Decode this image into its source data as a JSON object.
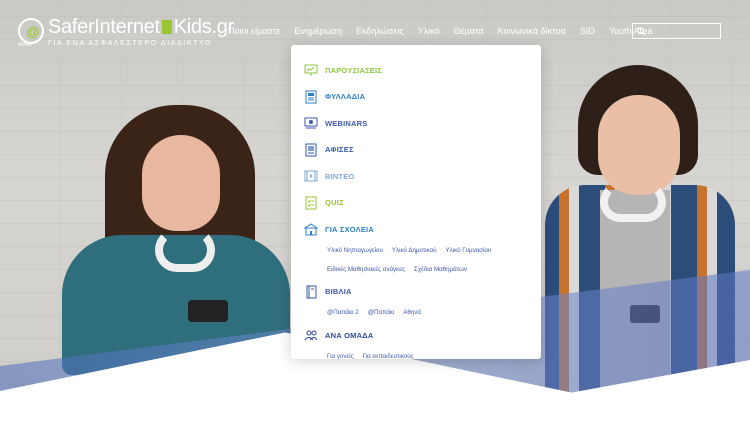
{
  "logo": {
    "part1": "SaferInternet",
    "part2": "Kids.gr",
    "tagline": "ΓΙΑ ΕΝΑ ΑΣΦΑΛΕΣΤΕΡΟ ΔΙΑΔΙΚΤΥΟ",
    "small": "www."
  },
  "nav": {
    "items": [
      {
        "label": "Ποιοι είμαστε"
      },
      {
        "label": "Ενημέρωση"
      },
      {
        "label": "Εκδηλώσεις"
      },
      {
        "label": "Υλικό"
      },
      {
        "label": "Θέματα"
      },
      {
        "label": "Κοινωνικά δίκτυα"
      },
      {
        "label": "SID"
      },
      {
        "label": "Youth Area"
      }
    ],
    "search_placeholder": ""
  },
  "menu": {
    "items": [
      {
        "label": "ΠΑΡΟΥΣΙΑΣΕΙΣ",
        "color": "#8dc63f",
        "icon": "presentation-icon"
      },
      {
        "label": "ΦΥΛΛΑΔΙΑ",
        "color": "#2f7fc8",
        "icon": "leaflet-icon"
      },
      {
        "label": "WEBINARS",
        "color": "#3d5aa8",
        "icon": "webinar-icon"
      },
      {
        "label": "ΑΦΙΣΕΣ",
        "color": "#2f5aa8",
        "icon": "poster-icon"
      },
      {
        "label": "ΒΙΝΤΕΟ",
        "color": "#7fa9d8",
        "icon": "video-icon"
      },
      {
        "label": "QUIZ",
        "color": "#9ac431",
        "icon": "quiz-icon"
      },
      {
        "label": "ΓΙΑ ΣΧΟΛΕΙΑ",
        "color": "#2f7fc8",
        "icon": "school-icon"
      },
      {
        "label": "ΒΙΒΛΙΑ",
        "color": "#3d5aa8",
        "icon": "book-icon"
      },
      {
        "label": "ΑΝΑ ΟΜΑΔΑ",
        "color": "#2f4a98",
        "icon": "group-icon"
      }
    ],
    "schools_sub": [
      "Υλικό Νηπιαγωγείου",
      "Υλικό Δημοτικού",
      "Υλικό Γυμνασίου",
      "Ειδικές Μαθησιακές ανάγκες",
      "Σχέδια Μαθημάτων"
    ],
    "books_sub": [
      "@Παπάκι 2",
      "@Παπάκι",
      "Αθηνά"
    ],
    "group_sub": [
      "Για γονείς",
      "Για εκπαιδευτικούς"
    ]
  }
}
